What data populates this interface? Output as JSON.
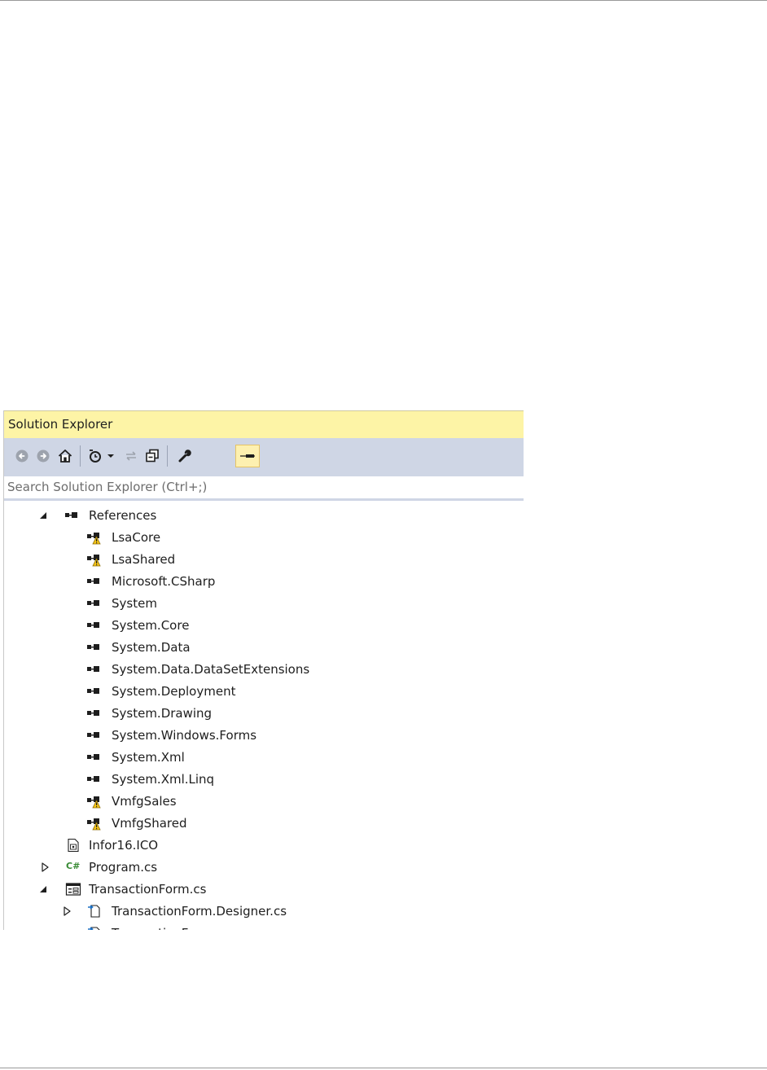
{
  "panel": {
    "title": "Solution Explorer",
    "search_placeholder": "Search Solution Explorer (Ctrl+;)"
  },
  "toolbar": [
    {
      "icon": "back-arrow-icon"
    },
    {
      "icon": "forward-arrow-icon"
    },
    {
      "icon": "home-icon"
    },
    {
      "icon": "pending-changes-filter-icon"
    },
    {
      "icon": "sync-icon"
    },
    {
      "icon": "collapse-all-icon"
    },
    {
      "icon": "properties-wrench-icon"
    },
    {
      "icon": "preview-selected-items-icon"
    }
  ],
  "tree": {
    "references_label": "References",
    "references": [
      {
        "label": "LsaCore",
        "warning": true
      },
      {
        "label": "LsaShared",
        "warning": true
      },
      {
        "label": "Microsoft.CSharp",
        "warning": false
      },
      {
        "label": "System",
        "warning": false
      },
      {
        "label": "System.Core",
        "warning": false
      },
      {
        "label": "System.Data",
        "warning": false
      },
      {
        "label": "System.Data.DataSetExtensions",
        "warning": false
      },
      {
        "label": "System.Deployment",
        "warning": false
      },
      {
        "label": "System.Drawing",
        "warning": false
      },
      {
        "label": "System.Windows.Forms",
        "warning": false
      },
      {
        "label": "System.Xml",
        "warning": false
      },
      {
        "label": "System.Xml.Linq",
        "warning": false
      },
      {
        "label": "VmfgSales",
        "warning": true
      },
      {
        "label": "VmfgShared",
        "warning": true
      }
    ],
    "files": {
      "icon_file": "Infor16.ICO",
      "program": "Program.cs",
      "csharp_badge": "C#",
      "transaction_form": "TransactionForm.cs",
      "designer": "TransactionForm.Designer.cs",
      "resx": "TransactionForm.resx"
    }
  }
}
